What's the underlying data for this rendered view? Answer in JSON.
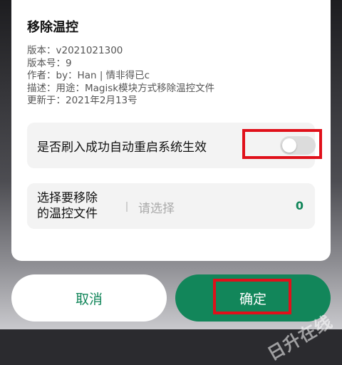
{
  "dialog": {
    "title": "移除温控",
    "meta": [
      "版本：v2021021300",
      "版本号：9",
      "作者：by：Han | 情非得已c",
      "描述：用途：Magisk模块方式移除温控文件",
      "更新于：2021年2月13号"
    ]
  },
  "reboot_option": {
    "label": "是否刷入成功自动重启系统生效",
    "enabled": false
  },
  "file_select": {
    "label_line1": "选择要移除",
    "label_line2": "的温控文件",
    "placeholder": "请选择",
    "count": "0"
  },
  "buttons": {
    "cancel": "取消",
    "ok": "确定"
  },
  "colors": {
    "accent": "#12865a",
    "highlight": "#e0101a"
  },
  "watermark": "日升在线"
}
